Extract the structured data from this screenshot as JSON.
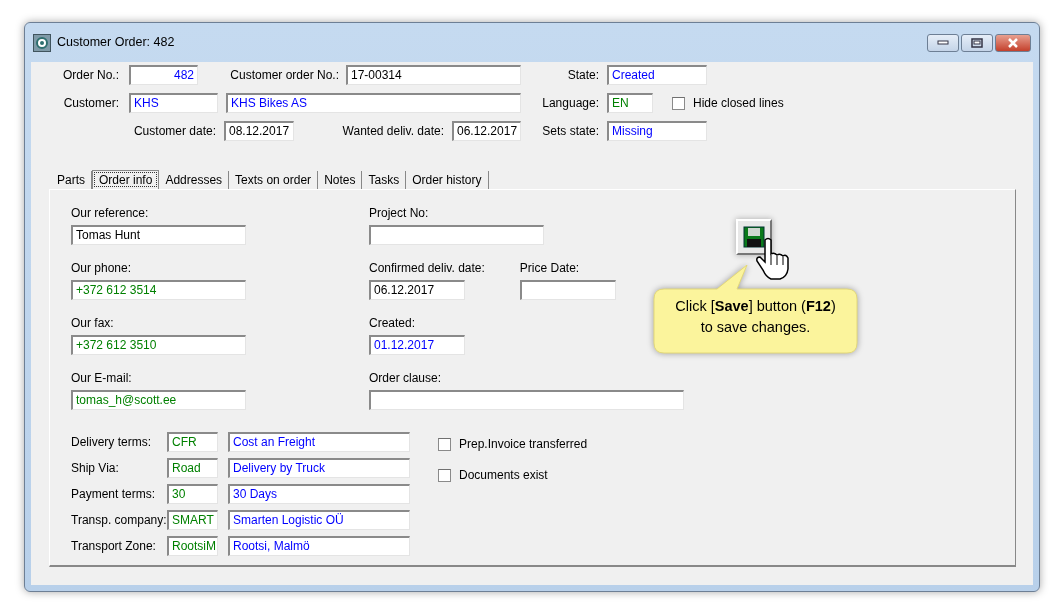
{
  "window": {
    "title": "Customer Order: 482"
  },
  "header": {
    "fields": [
      {
        "kind": "field",
        "label": "Order No.:",
        "values": [
          {
            "text": "482",
            "color": "#0000ff"
          }
        ]
      },
      {
        "kind": "field",
        "label": "Customer order No.:",
        "values": [
          {
            "text": "17-00314",
            "color": "#000000"
          }
        ]
      },
      {
        "kind": "field",
        "label": "State:",
        "values": [
          {
            "text": "Created",
            "color": "#0000ff"
          }
        ]
      },
      {
        "kind": "field",
        "label": "Customer:",
        "values": [
          {
            "text": "KHS",
            "color": "#0000ff"
          },
          {
            "text": "KHS Bikes AS",
            "color": "#0000ff"
          }
        ]
      },
      {
        "kind": "field",
        "label": "Language:",
        "values": [
          {
            "text": "EN",
            "color": "#008000"
          }
        ]
      },
      {
        "kind": "checkbox",
        "label": "Hide closed lines",
        "checked": false
      },
      {
        "kind": "field",
        "label": "Customer date:",
        "values": [
          {
            "text": "08.12.2017",
            "color": "#000000"
          }
        ]
      },
      {
        "kind": "field",
        "label": "Wanted deliv. date:",
        "values": [
          {
            "text": "06.12.2017",
            "color": "#000000"
          }
        ]
      },
      {
        "kind": "field",
        "label": "Sets state:",
        "values": [
          {
            "text": "Missing",
            "color": "#0000ff"
          }
        ]
      }
    ]
  },
  "tabs": [
    {
      "label": "Parts",
      "selected": false
    },
    {
      "label": "Order info",
      "selected": true
    },
    {
      "label": "Addresses",
      "selected": false
    },
    {
      "label": "Texts on order",
      "selected": false
    },
    {
      "label": "Notes",
      "selected": false
    },
    {
      "label": "Tasks",
      "selected": false
    },
    {
      "label": "Order history",
      "selected": false
    }
  ],
  "order_info": {
    "left_fields": [
      {
        "label": "Our reference:",
        "value": "Tomas Hunt",
        "color": "#000000"
      },
      {
        "label": "Our phone:",
        "value": "+372 612 3514",
        "color": "#008000"
      },
      {
        "label": "Our fax:",
        "value": "+372 612 3510",
        "color": "#008000"
      },
      {
        "label": "Our E-mail:",
        "value": "tomas_h@scott.ee",
        "color": "#008000"
      }
    ],
    "right_fields": [
      [
        {
          "label": "Project No:"
        }
      ],
      [
        {
          "label": "Confirmed deliv. date:",
          "value": "06.12.2017",
          "color": "#000000"
        },
        {
          "label": "Price Date:"
        }
      ],
      [
        {
          "label": "Created:",
          "value": "01.12.2017",
          "color": "#0000ff"
        }
      ],
      [
        {
          "label": "Order clause:"
        }
      ]
    ],
    "terms": [
      {
        "label": "Delivery terms:",
        "code": "CFR",
        "description": "Cost an Freight"
      },
      {
        "label": "Ship Via:",
        "code": "Road",
        "description": "Delivery by Truck"
      },
      {
        "label": "Payment terms:",
        "code": "30",
        "description": "30 Days"
      },
      {
        "label": "Transp. company:",
        "code": "SMART",
        "description": "Smarten Logistic OÜ"
      },
      {
        "label": "Transport Zone:",
        "code": "RootsiM",
        "description": "Rootsi, Malmö"
      }
    ],
    "checkboxes": [
      {
        "label": "Prep.Invoice transferred",
        "checked": false
      },
      {
        "label": "Documents exist",
        "checked": false
      }
    ]
  },
  "callout": {
    "text": "Click [**Save**] button (**F12**) to save changes."
  }
}
